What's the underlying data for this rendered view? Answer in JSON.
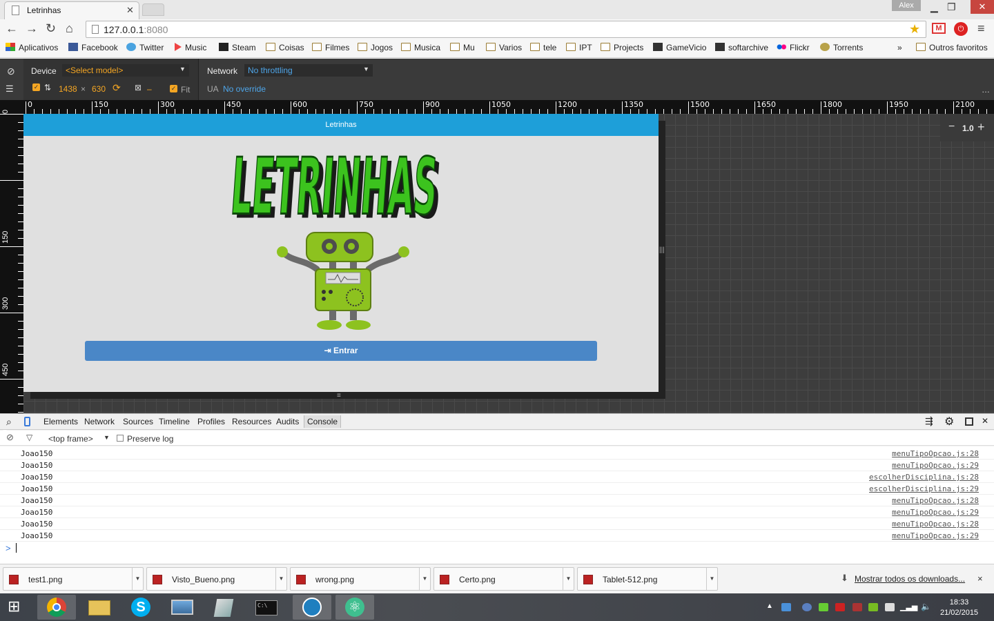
{
  "browser": {
    "tab_title": "Letrinhas",
    "user": "Alex",
    "url_host": "127.0.0.1",
    "url_port": ":8080"
  },
  "bookmarks": {
    "items": [
      "Aplicativos",
      "Facebook",
      "Twitter",
      "Music",
      "Steam",
      "Coisas",
      "Filmes",
      "Jogos",
      "Musica",
      "Mu",
      "Varios",
      "tele",
      "IPT",
      "Projects",
      "GameVicio",
      "softarchive",
      "Flickr",
      "Torrents"
    ],
    "more": "»",
    "other": "Outros favoritos"
  },
  "emulation": {
    "device_label": "Device",
    "device_value": "<Select model>",
    "network_label": "Network",
    "network_value": "No throttling",
    "width": "1438",
    "times": "×",
    "height": "630",
    "dash": "–",
    "fit": "Fit",
    "ua_label": "UA",
    "ua_value": "No override"
  },
  "ruler": {
    "top": [
      "0",
      "150",
      "300",
      "450",
      "600",
      "750",
      "900",
      "1050",
      "1200",
      "1350",
      "1500",
      "1650",
      "1800",
      "1950",
      "2100"
    ],
    "left": [
      "0",
      "150",
      "300",
      "450",
      "600"
    ]
  },
  "app": {
    "title": "Letrinhas",
    "logo_text": "LETRINHAS",
    "enter_label": "Entrar"
  },
  "zoom": {
    "minus": "−",
    "value": "1.0",
    "plus": "+"
  },
  "devtools": {
    "tabs": [
      "Elements",
      "Network",
      "Sources",
      "Timeline",
      "Profiles",
      "Resources",
      "Audits",
      "Console"
    ],
    "frame": "<top frame>",
    "preserve_log": "Preserve log",
    "logs": [
      {
        "msg": "Joao150",
        "src": "menuTipoOpcao.js:28"
      },
      {
        "msg": "Joao150",
        "src": "menuTipoOpcao.js:29"
      },
      {
        "msg": "Joao150",
        "src": "escolherDisciplina.js:28"
      },
      {
        "msg": "Joao150",
        "src": "escolherDisciplina.js:29"
      },
      {
        "msg": "Joao150",
        "src": "menuTipoOpcao.js:28"
      },
      {
        "msg": "Joao150",
        "src": "menuTipoOpcao.js:29"
      },
      {
        "msg": "Joao150",
        "src": "menuTipoOpcao.js:28"
      },
      {
        "msg": "Joao150",
        "src": "menuTipoOpcao.js:29"
      }
    ],
    "prompt": ">"
  },
  "downloads": {
    "files": [
      "test1.png",
      "Visto_Bueno.png",
      "wrong.png",
      "Certo.png",
      "Tablet-512.png"
    ],
    "show_all": "Mostrar todos os downloads...",
    "close": "×"
  },
  "taskbar": {
    "time": "18:33",
    "date": "21/02/2015"
  },
  "colors": {
    "app_bar": "#1e9fd9",
    "enter_button": "#4a87c7",
    "logo_green": "#3cc31e",
    "robot_green": "#8dc21f",
    "devtools_orange": "#f5a623",
    "devtools_blue": "#4ea6ea"
  }
}
